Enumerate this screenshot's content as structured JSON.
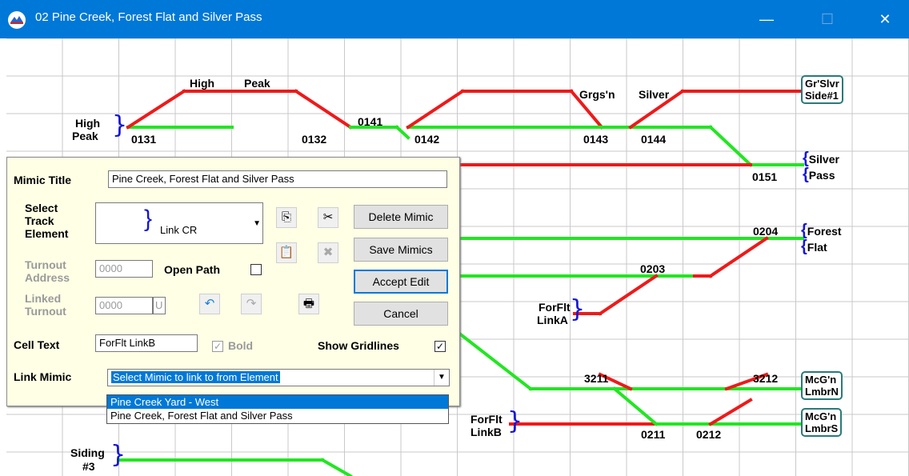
{
  "window": {
    "title": "02 Pine Creek, Forest Flat and Silver Pass",
    "minimize": "—",
    "maximize": "☐",
    "close": "✕"
  },
  "colors": {
    "titlebar": "#0078d7",
    "green_track": "#22e622",
    "red_track": "#ee1a1a",
    "grid": "#c9c9c9",
    "brace": "#1515d6",
    "box_border": "#2a7a7a",
    "dialog_bg": "#ffffe6",
    "selection": "#0078d7"
  },
  "mimic": {
    "labels": {
      "high": "High",
      "peak": "Peak",
      "grgsn": "Grgs'n",
      "silver": "Silver",
      "high_peak_1": "High",
      "high_peak_2": "Peak",
      "silver_pass_1": "Silver",
      "silver_pass_2": "Pass",
      "forest_flat_1": "Forest",
      "forest_flat_2": "Flat",
      "forflt_linka_1": "ForFlt",
      "forflt_linka_2": "LinkA",
      "forflt_linkb_1": "ForFlt",
      "forflt_linkb_2": "LinkB",
      "siding_1": "Siding",
      "siding_2": "#3"
    },
    "boxes": {
      "grslvr_1": "Gr'Slvr",
      "grslvr_2": "Side#1",
      "mcgn_n_1": "McG'n",
      "mcgn_n_2": "LmbrN",
      "mcgn_s_1": "McG'n",
      "mcgn_s_2": "LmbrS"
    },
    "addresses": {
      "a0131": "0131",
      "a0132": "0132",
      "a0141": "0141",
      "a0142": "0142",
      "a0143": "0143",
      "a0144": "0144",
      "a0151": "0151",
      "a0204": "0204",
      "a0203": "0203",
      "a3211": "3211",
      "a3212": "3212",
      "a0211": "0211",
      "a0212": "0212"
    }
  },
  "dialog": {
    "mimic_title_label": "Mimic Title",
    "mimic_title_value": "Pine Creek, Forest Flat and Silver Pass",
    "select_track_label_1": "Select",
    "select_track_label_2": "Track",
    "select_track_label_3": "Element",
    "select_track_value": "Link CR",
    "turnout_address_label_1": "Turnout",
    "turnout_address_label_2": "Address",
    "turnout_address_value": "0000",
    "open_path_label": "Open Path",
    "linked_turnout_label_1": "Linked",
    "linked_turnout_label_2": "Turnout",
    "linked_turnout_value": "0000",
    "linked_turnout_flag": "U",
    "cell_text_label": "Cell Text",
    "cell_text_value": "ForFlt LinkB",
    "bold_label": "Bold",
    "show_gridlines_label": "Show Gridlines",
    "link_mimic_label": "Link Mimic",
    "link_mimic_value": "Select Mimic to link to from Element",
    "buttons": {
      "delete": "Delete Mimic",
      "save": "Save Mimics",
      "accept": "Accept Edit",
      "cancel": "Cancel"
    },
    "checkmark": "✓",
    "icons": {
      "copy": "⎘",
      "cut": "✂",
      "paste": "📋",
      "delete_sel": "✖",
      "undo": "↶",
      "redo": "↷",
      "print": "🖶"
    },
    "dropdown_options": [
      "Pine Creek Yard - West",
      "Pine Creek, Forest Flat and Silver Pass"
    ]
  }
}
